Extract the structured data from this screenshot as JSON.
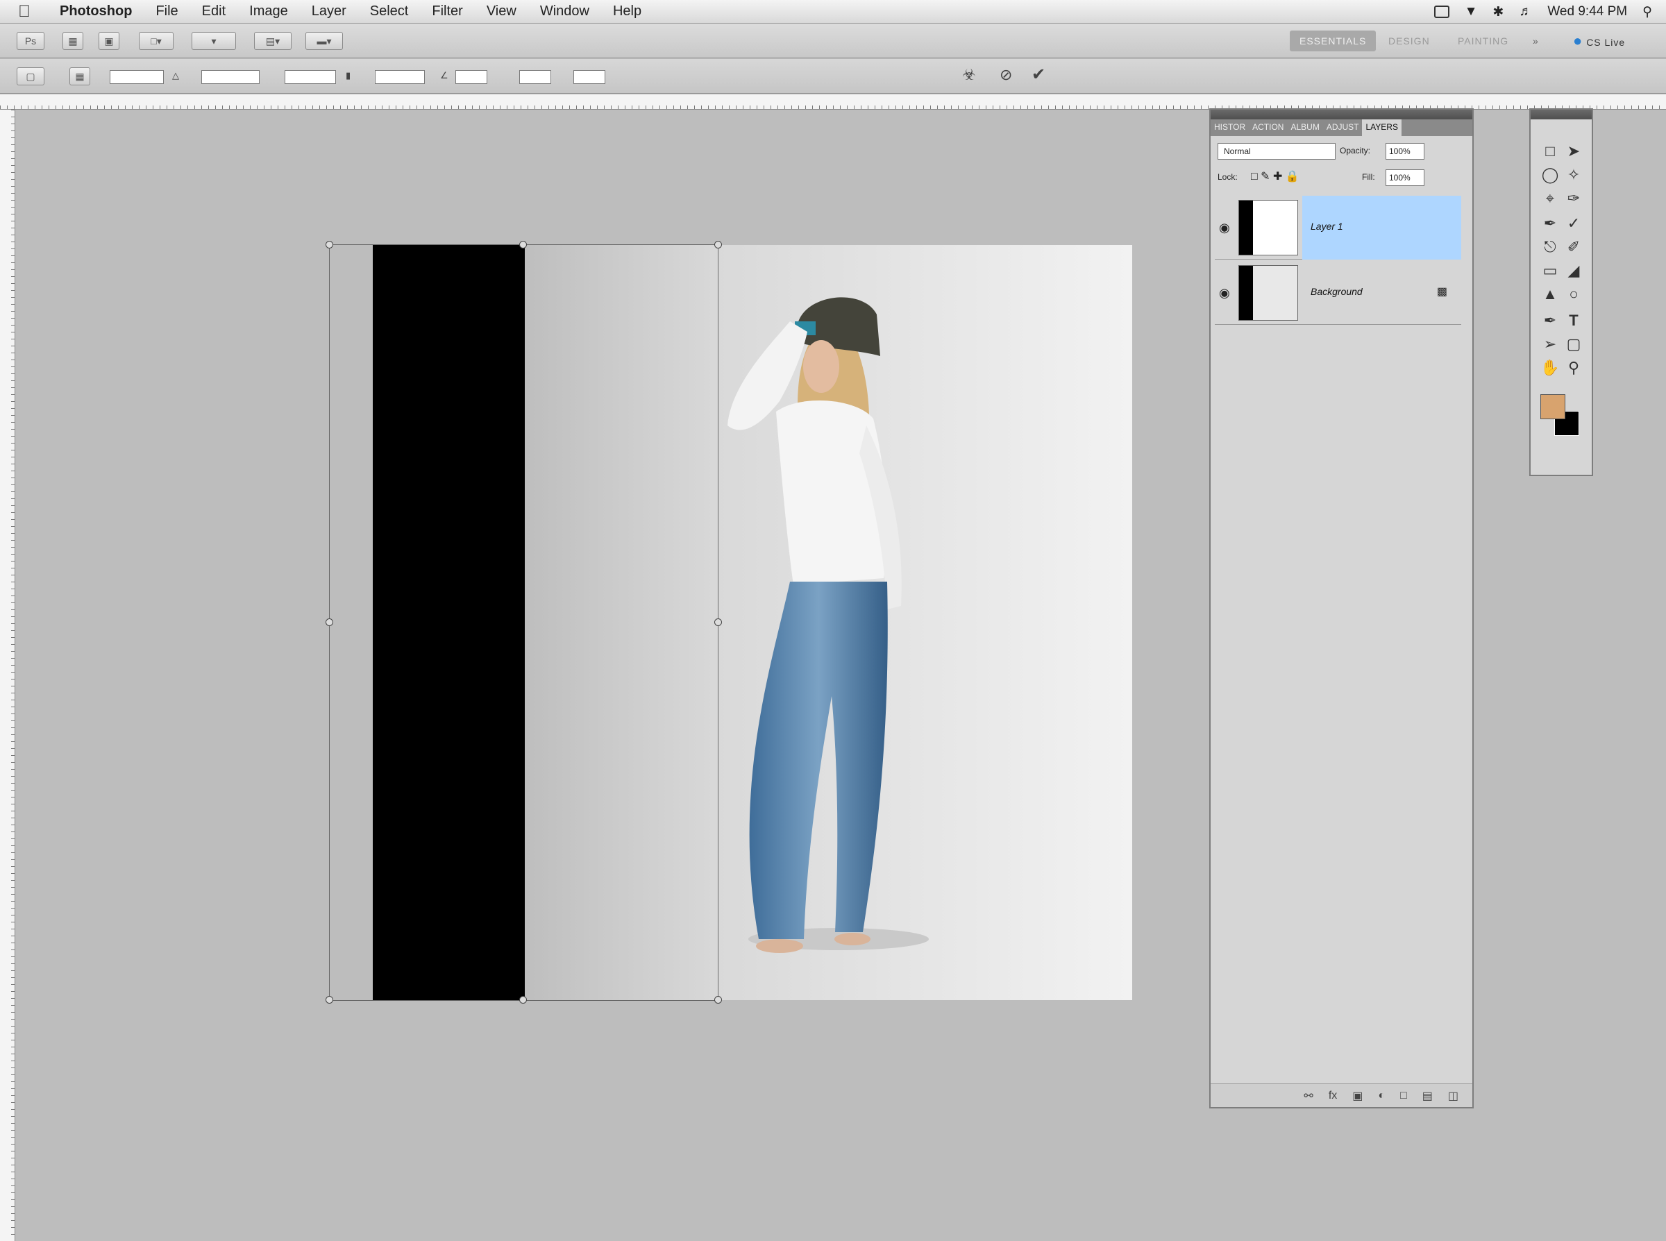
{
  "menubar": {
    "app_name": "Photoshop",
    "menus": [
      "File",
      "Edit",
      "Image",
      "Layer",
      "Select",
      "Filter",
      "View",
      "Window",
      "Help"
    ],
    "clock": "Wed 9:44 PM"
  },
  "workspaces": {
    "essentials": "ESSENTIALS",
    "design": "DESIGN",
    "painting": "PAINTING",
    "more": "»",
    "cs_live": "CS Live"
  },
  "layers_panel": {
    "tabs": [
      "HISTOR",
      "ACTION",
      "ALBUM",
      "ADJUST",
      "LAYERS"
    ],
    "blend_mode": "Normal",
    "opacity_label": "Opacity:",
    "opacity_value": "100%",
    "lock_label": "Lock:",
    "fill_label": "Fill:",
    "fill_value": "100%",
    "layers": [
      {
        "name": "Layer 1",
        "selected": true
      },
      {
        "name": "Background",
        "selected": false
      }
    ]
  },
  "colors": {
    "foreground": "#d8a36e",
    "background": "#000000",
    "selection": "#aed6ff"
  }
}
